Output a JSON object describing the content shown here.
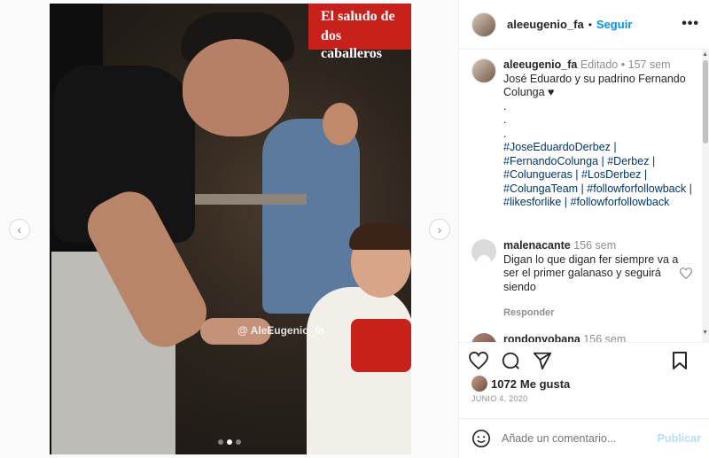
{
  "post": {
    "image_headline_1": "El saludo de",
    "image_headline_2": "dos caballeros",
    "watermark": "@ AleEugenio_fa",
    "carousel_dots": 3,
    "carousel_active_dot": 1
  },
  "header": {
    "username": "aleeugenio_fa",
    "separator": "•",
    "follow_label": "Seguir",
    "more_label": "•••"
  },
  "caption": {
    "username": "aleeugenio_fa",
    "edited_label": "Editado",
    "separator": "•",
    "time": "157 sem",
    "text": "José Eduardo y su padrino Fernando Colunga ♥",
    "dot_line_1": ".",
    "dot_line_2": ".",
    "dot_line_3": ".",
    "hashtags": "#JoseEduardoDerbez | #FernandoColunga | #Derbez | #Colungueras | #LosDerbez | #ColungaTeam | #followforfollowback | #likesforlike | #followforfollowback"
  },
  "comments": [
    {
      "username": "malenacante",
      "time": "156 sem",
      "text": "Digan lo que digan fer siempre va a ser el primer galanaso y seguirá siendo",
      "reply_label": "Responder"
    },
    {
      "username": "rondonyobana",
      "time": "156 sem",
      "text": ""
    }
  ],
  "likes": {
    "count": "1072",
    "label": "Me gusta"
  },
  "date": "JUNIO 4, 2020",
  "add_comment": {
    "placeholder": "Añade un comentario...",
    "publish_label": "Publicar"
  },
  "nav": {
    "prev": "‹",
    "next": "›"
  },
  "icons": {
    "like": "heart-icon",
    "comment": "comment-icon",
    "share": "paper-plane-icon",
    "save": "bookmark-icon",
    "emoji": "emoji-icon"
  }
}
